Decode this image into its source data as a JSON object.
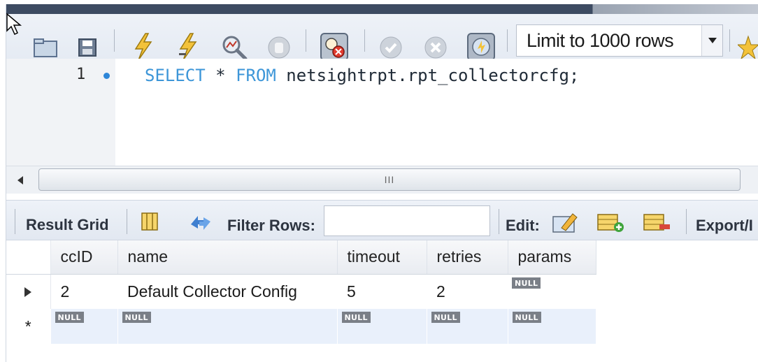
{
  "toolbar": {
    "icons": [
      "open-folder-icon",
      "save-icon",
      "execute-lightning-icon",
      "execute-cursor-lightning-icon",
      "explain-magnifier-icon",
      "stop-icon",
      "toggle-continue-on-error-icon",
      "commit-icon",
      "rollback-icon",
      "autocommit-icon"
    ],
    "limit_rows": {
      "value": "Limit to 1000 rows"
    }
  },
  "editor": {
    "line_number": "1",
    "sql_keyword_select": "SELECT",
    "sql_star": " * ",
    "sql_keyword_from": "FROM",
    "sql_table": " netsightrpt.rpt_collectorcfg;"
  },
  "scrollbar": {
    "grip": "III"
  },
  "result_toolbar": {
    "result_grid_label": "Result Grid",
    "filter_rows_label": "Filter Rows:",
    "filter_value": "",
    "edit_label": "Edit:",
    "export_label": "Export/I"
  },
  "grid": {
    "columns": [
      "ccID",
      "name",
      "timeout",
      "retries",
      "params"
    ],
    "rows": [
      {
        "ccID": "2",
        "name": "Default Collector Config",
        "timeout": "5",
        "retries": "2",
        "params": "NULL"
      }
    ],
    "new_row": {
      "marker": "*",
      "values": [
        "NULL",
        "NULL",
        "NULL",
        "NULL",
        "NULL"
      ]
    }
  },
  "colors": {
    "keyword": "#3d96d8",
    "accent_blue": "#2d86d8",
    "null_badge": "#7a7f87"
  }
}
